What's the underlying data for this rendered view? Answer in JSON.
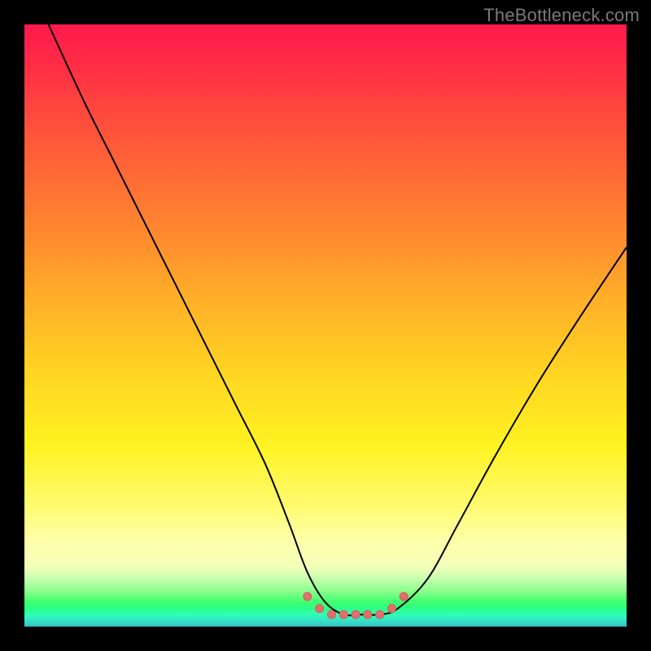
{
  "watermark": "TheBottleneck.com",
  "colors": {
    "frame": "#000000",
    "curve": "#000000",
    "marker_fill": "#e06f6d",
    "marker_stroke": "#d95c58"
  },
  "chart_data": {
    "type": "line",
    "title": "",
    "xlabel": "",
    "ylabel": "",
    "xlim": [
      0,
      100
    ],
    "ylim": [
      0,
      100
    ],
    "grid": false,
    "legend": false,
    "note": "No axis ticks or numeric labels are rendered; values below are read off relative pixel positions (0=left/bottom, 100=right/top) and rounded.",
    "series": [
      {
        "name": "bottleneck-curve",
        "x": [
          4,
          10,
          15,
          20,
          25,
          30,
          35,
          40,
          44,
          47,
          50,
          53,
          56,
          59,
          62,
          67,
          72,
          78,
          85,
          92,
          100
        ],
        "y": [
          100,
          87,
          77,
          67,
          57,
          47,
          37,
          27,
          17,
          9,
          4,
          2,
          2,
          2,
          3,
          8,
          17,
          28,
          40,
          51,
          63
        ]
      }
    ],
    "markers": {
      "name": "optimal-range",
      "note": "cluster of marker points along the valley floor",
      "x": [
        47,
        49,
        51,
        53,
        55,
        57,
        59,
        61,
        63
      ],
      "y": [
        5,
        3,
        2,
        2,
        2,
        2,
        2,
        3,
        5
      ],
      "radius_px": 5
    },
    "background_gradient": {
      "orientation": "vertical",
      "stops": [
        {
          "pos": 0.0,
          "color": "#ff1a4d"
        },
        {
          "pos": 0.35,
          "color": "#ff8a2e"
        },
        {
          "pos": 0.7,
          "color": "#fff222"
        },
        {
          "pos": 0.9,
          "color": "#f2ffb8"
        },
        {
          "pos": 0.97,
          "color": "#2bff87"
        },
        {
          "pos": 1.0,
          "color": "#39c1c1"
        }
      ]
    }
  }
}
